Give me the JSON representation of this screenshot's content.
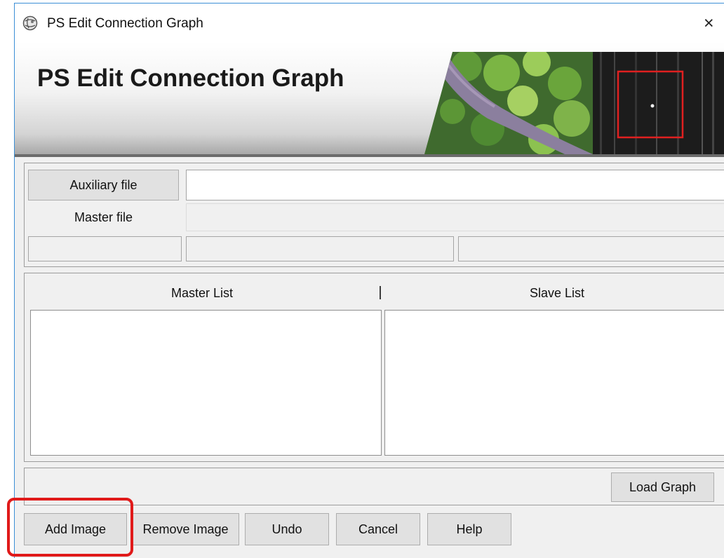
{
  "window": {
    "title": "PS Edit Connection Graph",
    "close_glyph": "×"
  },
  "banner": {
    "heading": "PS Edit Connection Graph"
  },
  "files": {
    "auxiliary_button": "Auxiliary file",
    "auxiliary_value": "",
    "master_label": "Master file",
    "master_value": ""
  },
  "lists": {
    "master_header": "Master List",
    "separator": "|",
    "slave_header": "Slave List"
  },
  "buttons": {
    "load_graph": "Load Graph",
    "add_image": "Add Image",
    "remove_image": "Remove Image",
    "undo": "Undo",
    "cancel": "Cancel",
    "help": "Help"
  },
  "colors": {
    "accent_border": "#3c8fd6",
    "highlight": "#e01a1a"
  }
}
